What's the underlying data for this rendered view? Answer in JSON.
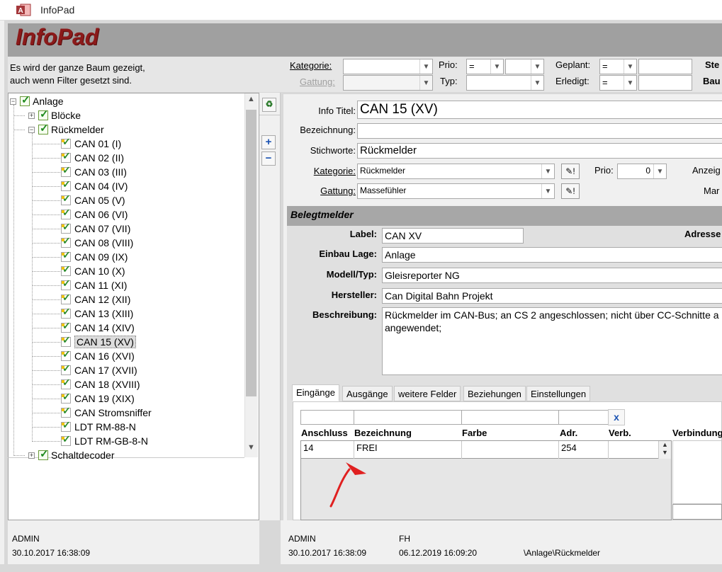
{
  "window": {
    "title": "InfoPad",
    "app_header": "InfoPad"
  },
  "filter": {
    "hint_line1": "Es wird der ganze Baum gezeigt,",
    "hint_line2": "auch wenn Filter gesetzt sind.",
    "kategorie_label": "Kategorie:",
    "gattung_label": "Gattung:",
    "prio_label": "Prio:",
    "prio_op": "=",
    "typ_label": "Typ:",
    "geplant_label": "Geplant:",
    "geplant_op": "=",
    "erledigt_label": "Erledigt:",
    "erledigt_op": "=",
    "ste_label": "Ste",
    "bau_label": "Bau"
  },
  "tree": {
    "root": "Anlage",
    "bloecke": "Blöcke",
    "rueckmelder": "Rückmelder",
    "items": [
      "CAN 01 (I)",
      "CAN 02 (II)",
      "CAN 03 (III)",
      "CAN 04 (IV)",
      "CAN 05 (V)",
      "CAN 06 (VI)",
      "CAN 07 (VII)",
      "CAN 08 (VIII)",
      "CAN 09 (IX)",
      "CAN 10 (X)",
      "CAN 11 (XI)",
      "CAN 12 (XII)",
      "CAN 13 (XIII)",
      "CAN 14 (XIV)",
      "CAN 15 (XV)",
      "CAN 16 (XVI)",
      "CAN 17 (XVII)",
      "CAN 18 (XVIII)",
      "CAN 19 (XIX)",
      "CAN Stromsniffer",
      "LDT RM-88-N",
      "LDT RM-GB-8-N"
    ],
    "schaltdecoder": "Schaltdecoder",
    "selected_index": 14
  },
  "footer_left": {
    "user": "ADMIN",
    "date": "30.10.2017 16:38:09"
  },
  "detail": {
    "info_titel_label": "Info Titel:",
    "info_titel": "CAN 15 (XV)",
    "bezeichnung_label": "Bezeichnung:",
    "bezeichnung": "",
    "stichworte_label": "Stichworte:",
    "stichworte": "Rückmelder",
    "kategorie_label": "Kategorie:",
    "kategorie": "Rückmelder",
    "prio_label": "Prio:",
    "prio": "0",
    "anzeig_label": "Anzeig",
    "gattung_label": "Gattung:",
    "gattung": "Massefühler",
    "mar_label": "Mar"
  },
  "section": {
    "title": "Belegtmelder",
    "label_label": "Label:",
    "label": "CAN XV",
    "adresse_label": "Adresse",
    "einbau_label": "Einbau Lage:",
    "einbau": "Anlage",
    "modell_label": "Modell/Typ:",
    "modell": "Gleisreporter NG",
    "hersteller_label": "Hersteller:",
    "hersteller": "Can Digital Bahn Projekt",
    "beschreibung_label": "Beschreibung:",
    "beschreibung_line1": "Rückmelder im CAN-Bus; an CS 2 angeschlossen; nicht über CC-Schnitte a",
    "beschreibung_line2": "angewendet;"
  },
  "tabs": [
    "Eingänge",
    "Ausgänge",
    "weitere Felder",
    "Beziehungen",
    "Einstellungen"
  ],
  "table": {
    "clear_button": "x",
    "headers": [
      "Anschluss",
      "Bezeichnung",
      "Farbe",
      "Adr.",
      "Verb.",
      "Verbindung"
    ],
    "row": {
      "anschluss": "14",
      "bezeichnung": "FREI",
      "farbe": "",
      "adr": "254",
      "verb": ""
    }
  },
  "footer_right": {
    "user1": "ADMIN",
    "date1": "30.10.2017 16:38:09",
    "user2": "FH",
    "date2": "06.12.2019 16:09:20",
    "path": "\\Anlage\\Rückmelder"
  },
  "colors": {
    "header_band": "#a0a0a0",
    "title_red": "#8b1a1a",
    "annotation_arrow": "#e02020"
  },
  "icons": [
    "access-app-icon",
    "checked-box-icon",
    "leaf-check-icon",
    "expand-plus-icon",
    "collapse-minus-icon",
    "recycle-icon",
    "add-plus-icon",
    "remove-minus-icon",
    "edit-pencil-icon",
    "chevron-down-icon",
    "chevron-up-icon",
    "red-arrow-annotation"
  ]
}
